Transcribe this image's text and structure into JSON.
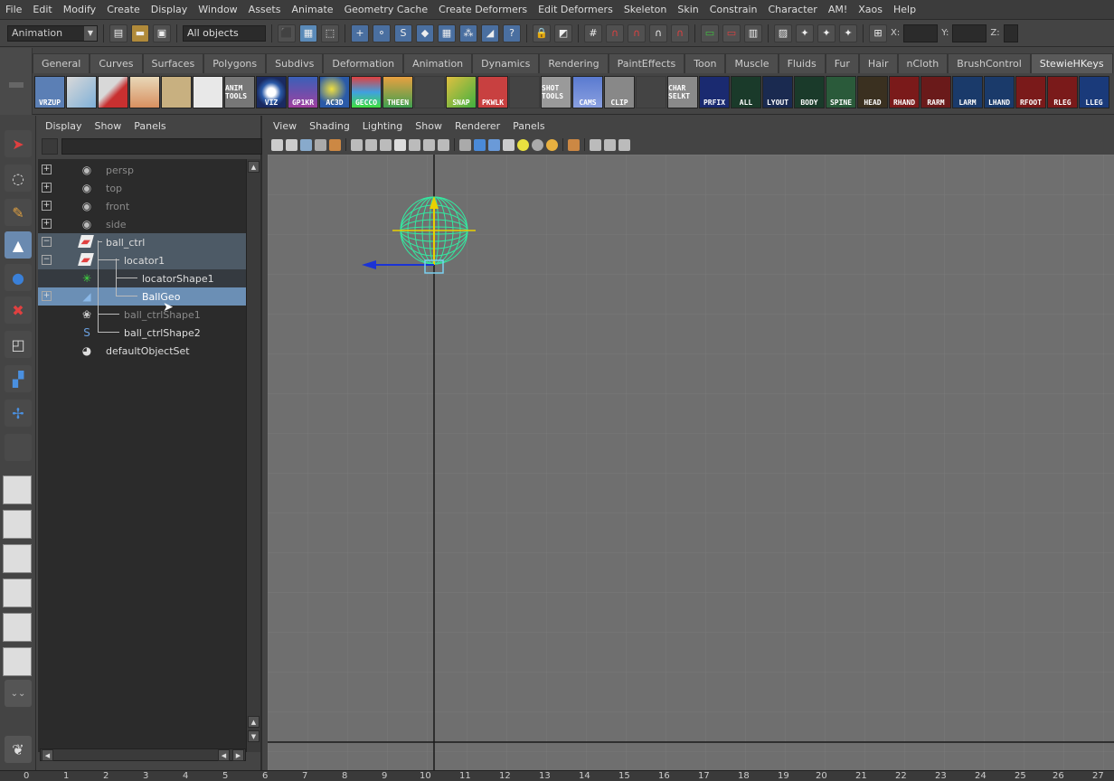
{
  "menubar": {
    "items": [
      "File",
      "Edit",
      "Modify",
      "Create",
      "Display",
      "Window",
      "Assets",
      "Animate",
      "Geometry Cache",
      "Create Deformers",
      "Edit Deformers",
      "Skeleton",
      "Skin",
      "Constrain",
      "Character",
      "AM!",
      "Xaos",
      "Help"
    ]
  },
  "statusline": {
    "mode": "Animation",
    "object_selector": "All objects",
    "x_label": "X:",
    "y_label": "Y:",
    "z_label": "Z:"
  },
  "shelf": {
    "tabs": [
      "General",
      "Curves",
      "Surfaces",
      "Polygons",
      "Subdivs",
      "Deformation",
      "Animation",
      "Dynamics",
      "Rendering",
      "PaintEffects",
      "Toon",
      "Muscle",
      "Fluids",
      "Fur",
      "Hair",
      "nCloth",
      "BrushControl",
      "StewieHKeys"
    ],
    "icons": [
      "VRZUP",
      "",
      "",
      "",
      "",
      "",
      "ANIM TOOLS",
      "VIZ",
      "GP1KR",
      "AC3D",
      "GECCO",
      "THEEN",
      "",
      "SNAP",
      "PKWLK",
      "",
      "SHOT TOOLS",
      "CAMS",
      "CLIP",
      "",
      "CHAR SELKT",
      "PRFIX",
      "ALL",
      "LYOUT",
      "BODY",
      "SPINE",
      "HEAD",
      "RHAND",
      "RARM",
      "LARM",
      "LHAND",
      "RFOOT",
      "RLEG",
      "LLEG"
    ]
  },
  "outliner": {
    "menu": [
      "Display",
      "Show",
      "Panels"
    ],
    "rows": [
      {
        "label": "persp"
      },
      {
        "label": "top"
      },
      {
        "label": "front"
      },
      {
        "label": "side"
      },
      {
        "label": "ball_ctrl"
      },
      {
        "label": "locator1"
      },
      {
        "label": "locatorShape1"
      },
      {
        "label": "BallGeo"
      },
      {
        "label": "ball_ctrlShape1"
      },
      {
        "label": "ball_ctrlShape2"
      },
      {
        "label": "defaultObjectSet"
      }
    ]
  },
  "viewport": {
    "menu": [
      "View",
      "Shading",
      "Lighting",
      "Show",
      "Renderer",
      "Panels"
    ]
  },
  "timeline": {
    "ticks": [
      "0",
      "1",
      "2",
      "3",
      "4",
      "5",
      "6",
      "7",
      "8",
      "9",
      "10",
      "11",
      "12",
      "13",
      "14",
      "15",
      "16",
      "17",
      "18",
      "19",
      "20",
      "21",
      "22",
      "23",
      "24",
      "25",
      "26",
      "27"
    ]
  },
  "colors": {
    "viewport_bg": "#6f6f6f",
    "wire_sphere": "#34e8a0",
    "selection_blue": "#6b8fb5",
    "manip_yellow": "#e8d000",
    "manip_blue": "#1a33d6"
  }
}
